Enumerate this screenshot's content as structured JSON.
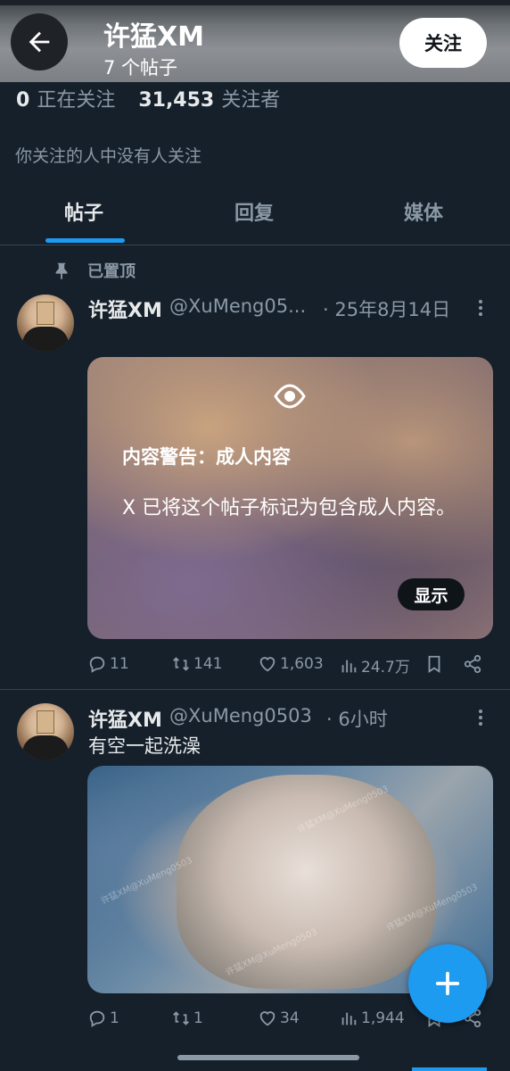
{
  "header": {
    "name": "许猛XM",
    "post_count": "7 个帖子",
    "follow_label": "关注"
  },
  "stats": {
    "following_count": "0",
    "following_label": "正在关注",
    "followers_count": "31,453",
    "followers_label": "关注者"
  },
  "follow_note": "你关注的人中没有人关注",
  "tabs": [
    {
      "label": "帖子",
      "active": true
    },
    {
      "label": "回复",
      "active": false
    },
    {
      "label": "媒体",
      "active": false
    }
  ],
  "tweets": [
    {
      "pinned_label": "已置顶",
      "name": "许猛XM",
      "handle": "@XuMeng05...",
      "time": "· 25年8月14日",
      "warning": {
        "title": "内容警告：成人内容",
        "text": "X 已将这个帖子标记为包含成人内容。",
        "show_label": "显示"
      },
      "replies": "11",
      "retweets": "141",
      "likes": "1,603",
      "views": "24.7万"
    },
    {
      "name": "许猛XM",
      "handle": "@XuMeng0503",
      "time": "· 6小时",
      "text": "有空一起洗澡",
      "watermark": "许猛XM@XuMeng0503",
      "replies": "1",
      "retweets": "1",
      "likes": "34",
      "views": "1,944"
    }
  ],
  "colors": {
    "background": "#15202b",
    "accent": "#1d9bf0",
    "secondary_text": "#8b98a5"
  }
}
